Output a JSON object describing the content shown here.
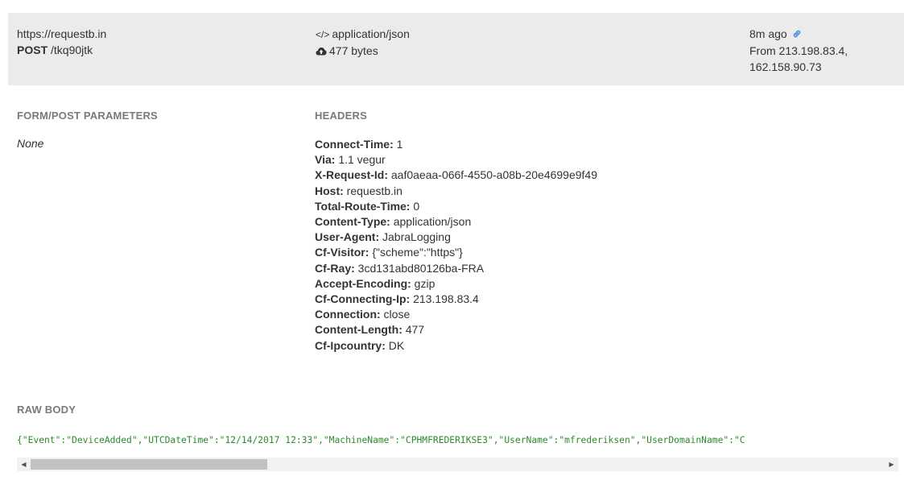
{
  "request": {
    "url": "https://requestb.in",
    "method": "POST",
    "path": "/tkq90jtk",
    "content_type": "application/json",
    "size": "477 bytes",
    "time_ago": "8m ago",
    "from_line1": "From 213.198.83.4,",
    "from_line2": "162.158.90.73",
    "code_icon": "</>"
  },
  "sections": {
    "form_title": "FORM/POST PARAMETERS",
    "form_value": "None",
    "headers_title": "HEADERS",
    "raw_title": "RAW BODY"
  },
  "headers": [
    {
      "key": "Connect-Time:",
      "value": "1"
    },
    {
      "key": "Via:",
      "value": "1.1 vegur"
    },
    {
      "key": "X-Request-Id:",
      "value": "aaf0aeaa-066f-4550-a08b-20e4699e9f49"
    },
    {
      "key": "Host:",
      "value": "requestb.in"
    },
    {
      "key": "Total-Route-Time:",
      "value": "0"
    },
    {
      "key": "Content-Type:",
      "value": "application/json"
    },
    {
      "key": "User-Agent:",
      "value": "JabraLogging"
    },
    {
      "key": "Cf-Visitor:",
      "value": "{\"scheme\":\"https\"}"
    },
    {
      "key": "Cf-Ray:",
      "value": "3cd131abd80126ba-FRA"
    },
    {
      "key": "Accept-Encoding:",
      "value": "gzip"
    },
    {
      "key": "Cf-Connecting-Ip:",
      "value": "213.198.83.4"
    },
    {
      "key": "Connection:",
      "value": "close"
    },
    {
      "key": "Content-Length:",
      "value": "477"
    },
    {
      "key": "Cf-Ipcountry:",
      "value": "DK"
    }
  ],
  "raw_body": "{\"Event\":\"DeviceAdded\",\"UTCDateTime\":\"12/14/2017 12:33\",\"MachineName\":\"CPHMFREDERIKSE3\",\"UserName\":\"mfrederiksen\",\"UserDomainName\":\"C",
  "scroll_arrows": {
    "left": "◀",
    "right": "▶"
  },
  "colors": {
    "panel_bg": "#ebebeb",
    "section_title": "#7a7a7a",
    "raw_body_text": "#2c8a2c",
    "link_icon": "#4a90e2"
  },
  "icons": {
    "code": "code-icon",
    "cloud": "cloud-upload-icon",
    "link": "link-icon"
  }
}
